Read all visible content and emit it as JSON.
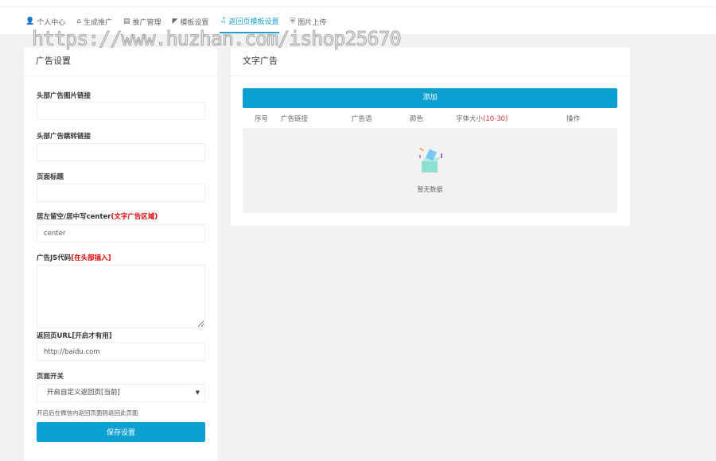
{
  "watermark": "https://www.huzhan.com/ishop25670",
  "nav": [
    {
      "label": "个人中心",
      "icon": "user-icon"
    },
    {
      "label": "生成推广",
      "icon": "home-icon"
    },
    {
      "label": "推广管理",
      "icon": "list-icon"
    },
    {
      "label": "模板设置",
      "icon": "leaf-icon"
    },
    {
      "label": "返回页模板设置",
      "icon": "bell-icon",
      "active": true
    },
    {
      "label": "图片上传",
      "icon": "shield-icon"
    }
  ],
  "left": {
    "title": "广告设置",
    "fields": {
      "header_img": {
        "label": "头部广告图片链接",
        "value": ""
      },
      "header_link": {
        "label": "头部广告跳转链接",
        "value": ""
      },
      "page_title": {
        "label": "页面标题",
        "value": ""
      },
      "align": {
        "label": "居左留空/居中写center",
        "note": "(文字广告区域)",
        "value": "center"
      },
      "js": {
        "label": "广告JS代码",
        "note": "[在头部插入]",
        "value": ""
      },
      "return_url": {
        "label": "返回页URL[开启才有用]",
        "value": "http://baidu.com"
      },
      "switch": {
        "label": "页面开关",
        "value": "开启自定义返回页[当前]",
        "help": "开启后在微信内返回页面则返回此页面"
      }
    },
    "save": "保存设置"
  },
  "right": {
    "title": "文字广告",
    "add": "添加",
    "columns": [
      "序号",
      "广告链接",
      "广告语",
      "颜色",
      "字体大小",
      "操作"
    ],
    "size_range": "(10-30)",
    "empty": "暂无数据"
  },
  "colors": {
    "accent": "#0ba0d1",
    "red": "#dd0000"
  }
}
